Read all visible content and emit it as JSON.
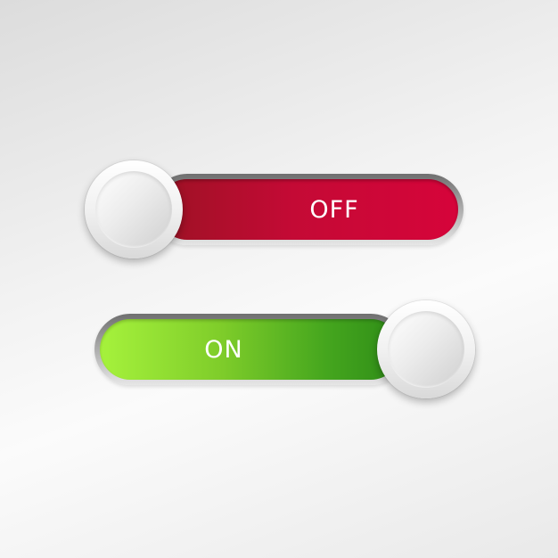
{
  "toggles": {
    "off": {
      "label": "OFF",
      "state": "off",
      "track_color": "#c40a35"
    },
    "on": {
      "label": "ON",
      "state": "on",
      "track_color": "#45a61e"
    }
  }
}
